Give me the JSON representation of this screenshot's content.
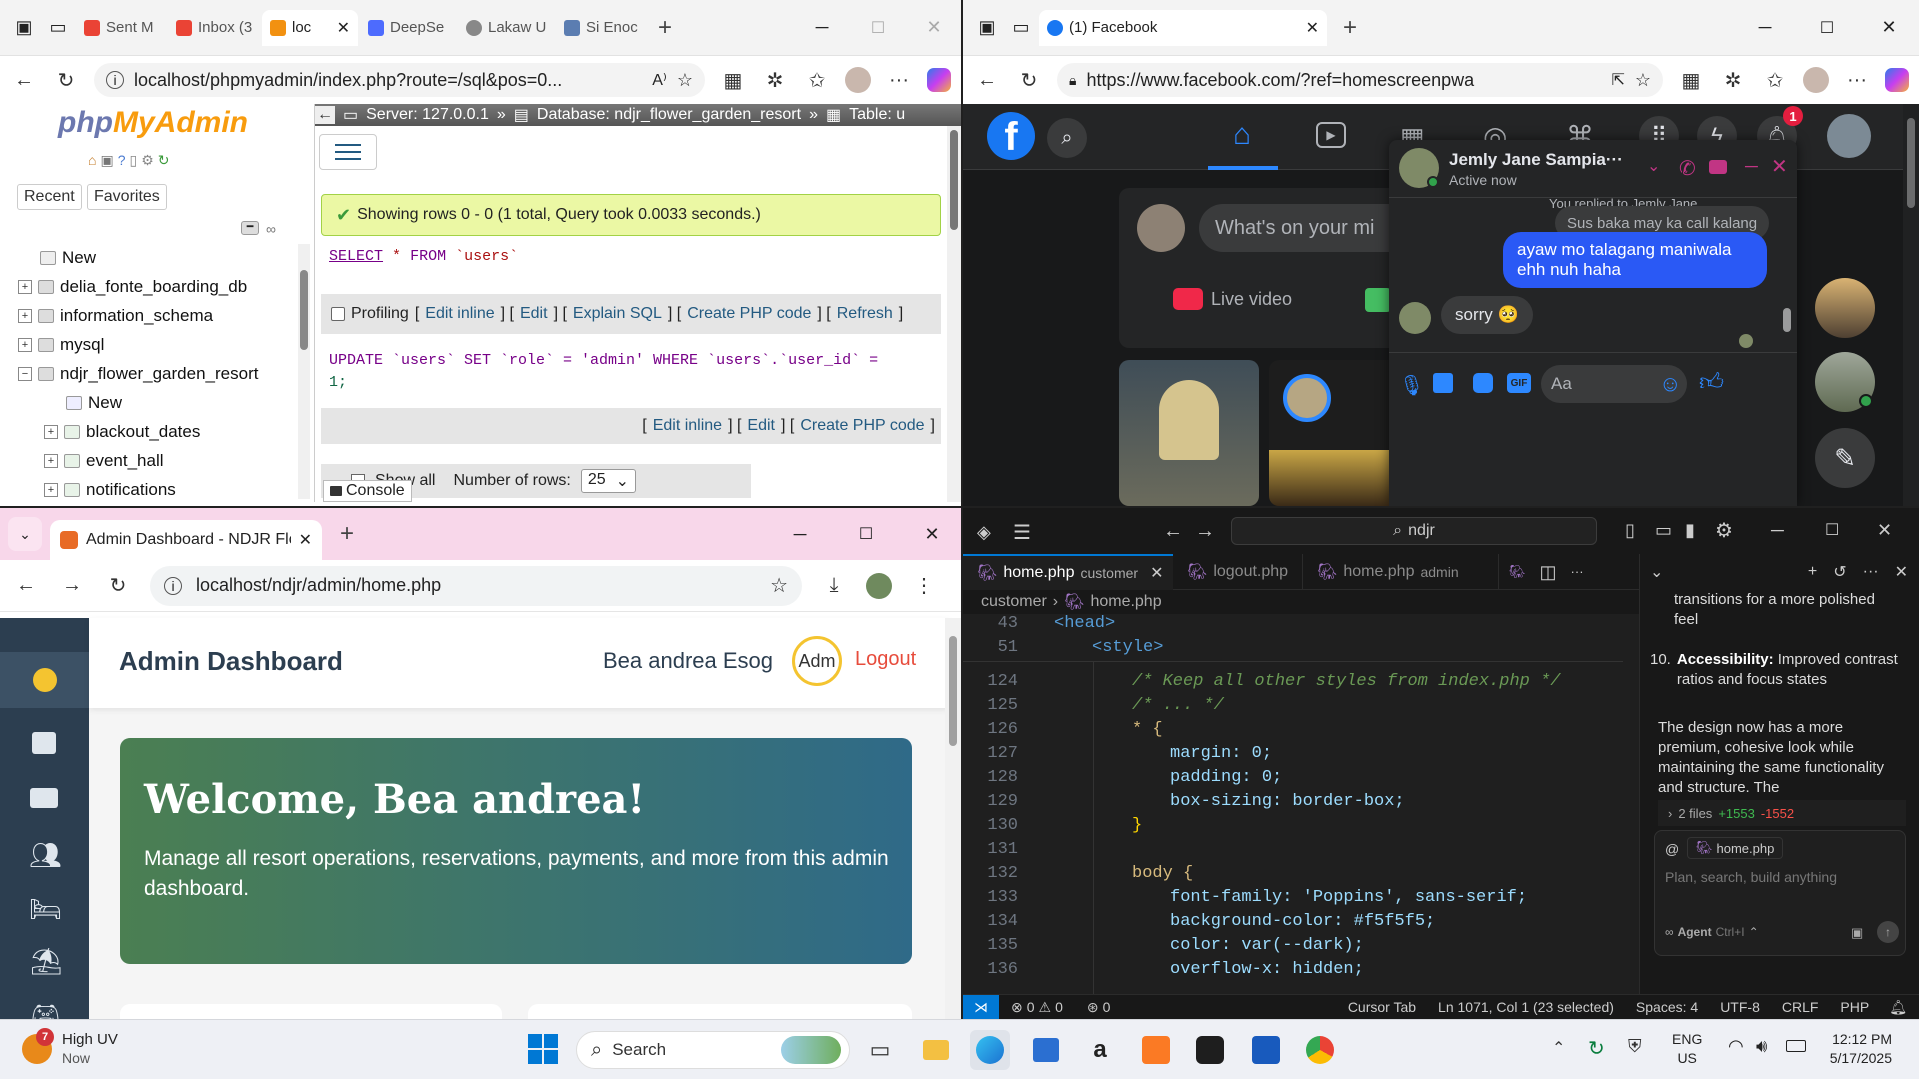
{
  "phpmyadmin_window": {
    "tabs": [
      {
        "label": "Sent M"
      },
      {
        "label": "Inbox (3"
      },
      {
        "label": "loc"
      },
      {
        "label": "DeepSe"
      },
      {
        "label": "Lakaw U"
      },
      {
        "label": "Si Enoc"
      }
    ],
    "url": "localhost/phpmyadmin/index.php?route=/sql&pos=0...",
    "logo_text_a": "php",
    "logo_text_b": "MyAdmin",
    "recent_tab": "Recent",
    "favorites_tab": "Favorites",
    "tree": [
      {
        "label": "New"
      },
      {
        "label": "delia_fonte_boarding_db"
      },
      {
        "label": "information_schema"
      },
      {
        "label": "mysql"
      },
      {
        "label": "ndjr_flower_garden_resort"
      },
      {
        "label": "New"
      },
      {
        "label": "blackout_dates"
      },
      {
        "label": "event_hall"
      },
      {
        "label": "notifications"
      }
    ],
    "breadcrumb_server": "Server: 127.0.0.1",
    "breadcrumb_database": "Database: ndjr_flower_garden_resort",
    "breadcrumb_table": "Table: u",
    "success_message": "Showing rows 0 - 0 (1 total, Query took 0.0033 seconds.)",
    "query1": {
      "kw1": "SELECT",
      "star": "*",
      "kw2": "FROM",
      "table": "`users`"
    },
    "profiling_label": "Profiling",
    "query1_links": [
      "Edit inline",
      "Edit",
      "Explain SQL",
      "Create PHP code",
      "Refresh"
    ],
    "query2": {
      "line1": "UPDATE `users` SET `role` = 'admin' WHERE `users`.`user_id` =",
      "line2": "1;"
    },
    "query2_links": [
      "Edit inline",
      "Edit",
      "Create PHP code"
    ],
    "show_all_label": "Show all",
    "number_of_rows_label": "Number of rows:",
    "number_of_rows_value": "25",
    "console_label": "Console"
  },
  "facebook_window": {
    "tab_title": "(1) Facebook",
    "url": "https://www.facebook.com/?ref=homescreenpwa",
    "notification_count": "1",
    "post_prompt": "What's on your mi",
    "live_video_label": "Live video",
    "chat": {
      "name": "Jemly Jane Sampia···",
      "status": "Active now",
      "replied_note": "You replied to Jemly Jane",
      "quoted_message": "Sus baka may ka call kalang",
      "my_message": "ayaw mo talagang maniwala ehh nuh haha",
      "their_message": "sorry 🥺",
      "input_placeholder": "Aa"
    }
  },
  "chrome_window": {
    "tab_title": "Admin Dashboard - NDJR Flow",
    "url": "localhost/ndjr/admin/home.php",
    "header_title": "Admin Dashboard",
    "user_name": "Bea andrea Esog",
    "avatar_alt": "Adm",
    "logout_label": "Logout",
    "welcome_title": "Welcome, Bea andrea!",
    "welcome_text": "Manage all resort operations, reservations, payments, and more from this admin dashboard."
  },
  "vscode_window": {
    "search_text": "ndjr",
    "tabs": [
      {
        "label": "home.php",
        "detail": "customer"
      },
      {
        "label": "logout.php",
        "detail": ""
      },
      {
        "label": "home.php",
        "detail": "admin"
      }
    ],
    "breadcrumb_folder": "customer",
    "breadcrumb_file": "home.php",
    "sticky_lines": [
      {
        "num": "43",
        "text": "<head>"
      },
      {
        "num": "51",
        "text": "<style>"
      }
    ],
    "code_lines": [
      {
        "num": "124",
        "text": "/* Keep all other styles from index.php */"
      },
      {
        "num": "125",
        "text": "/* ... */"
      },
      {
        "num": "126",
        "text": "* {"
      },
      {
        "num": "127",
        "text": "margin: 0;"
      },
      {
        "num": "128",
        "text": "padding: 0;"
      },
      {
        "num": "129",
        "text": "box-sizing: border-box;"
      },
      {
        "num": "130",
        "text": "}"
      },
      {
        "num": "131",
        "text": ""
      },
      {
        "num": "132",
        "text": "body {"
      },
      {
        "num": "133",
        "text": "font-family: 'Poppins', sans-serif;"
      },
      {
        "num": "134",
        "text": "background-color: #f5f5f5;"
      },
      {
        "num": "135",
        "text": "color: var(--dark);"
      },
      {
        "num": "136",
        "text": "overflow-x: hidden;"
      }
    ],
    "chat_panel": {
      "line_a": "transitions for a more polished feel",
      "item10_number": "10.",
      "item10_bold": "Accessibility:",
      "item10_text": "Improved contrast ratios and focus states",
      "summary": "The design now has a more premium, cohesive look while maintaining the same functionality and structure. The",
      "files_changed": "2 files",
      "added": "+1553",
      "removed": "-1552",
      "context_file": "home.php",
      "input_placeholder": "Plan, search, build anything",
      "agent_label": "Agent",
      "agent_shortcut": "Ctrl+I"
    },
    "status_bar": {
      "errors": "0",
      "warnings": "0",
      "ports": "0",
      "cursor_tab": "Cursor Tab",
      "position": "Ln 1071, Col 1 (23 selected)",
      "spaces": "Spaces: 4",
      "encoding": "UTF-8",
      "eol": "CRLF",
      "language": "PHP"
    }
  },
  "taskbar": {
    "weather_badge": "7",
    "weather_title": "High UV",
    "weather_sub": "Now",
    "search_label": "Search",
    "language": "ENG",
    "region": "US",
    "time": "12:12 PM",
    "date": "5/17/2025"
  }
}
